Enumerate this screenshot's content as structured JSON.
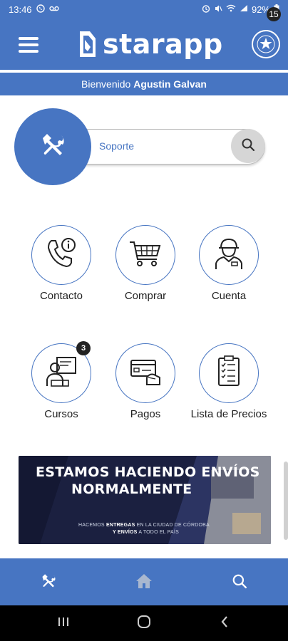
{
  "status_bar": {
    "time": "13:46",
    "battery": "92%",
    "icons": [
      "whatsapp-icon",
      "voicemail-icon",
      "alarm-icon",
      "mute-icon",
      "wifi-icon",
      "signal-icon",
      "battery-icon"
    ]
  },
  "app_bar": {
    "brand": "starapp",
    "notification_count": "15",
    "icons": [
      "menu-icon",
      "starapp-logo",
      "avatar-icon"
    ]
  },
  "welcome": {
    "greeting": "Bienvenido",
    "user_name": "Agustin Galvan"
  },
  "support": {
    "label": "Soporte",
    "icon": "tools-icon",
    "search_icon": "search-icon"
  },
  "tiles": [
    {
      "label": "Contacto",
      "icon": "phone-info-icon"
    },
    {
      "label": "Comprar",
      "icon": "shopping-cart-icon"
    },
    {
      "label": "Cuenta",
      "icon": "worker-account-icon"
    },
    {
      "label": "Cursos",
      "icon": "courses-icon",
      "badge": "3"
    },
    {
      "label": "Pagos",
      "icon": "payment-card-icon"
    },
    {
      "label": "Lista de Precios",
      "icon": "price-list-icon"
    }
  ],
  "banner": {
    "title_line1": "ESTAMOS HACIENDO ENVÍOS",
    "title_line2": "NORMALMENTE",
    "line1_pre": "HACEMOS",
    "line1_bold": "ENTREGAS",
    "line1_post": "EN LA CIUDAD DE CÓRDOBA",
    "line2_bold": "Y ENVÍOS",
    "line2_post": "A TODO EL PAÍS"
  },
  "bottom_nav": {
    "items": [
      "tools-icon",
      "home-icon",
      "search-icon"
    ]
  },
  "system_nav": {
    "items": [
      "recent-apps-icon",
      "home-button-icon",
      "back-icon"
    ]
  },
  "colors": {
    "primary": "#4775c2",
    "banner_bg": "#1b2040",
    "badge": "#222222"
  }
}
